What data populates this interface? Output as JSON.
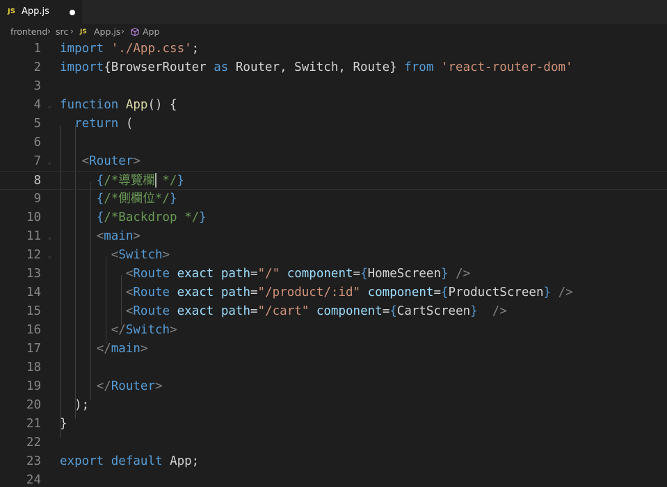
{
  "tab": {
    "badge": "JS",
    "label": "App.js"
  },
  "breadcrumb": {
    "parts": [
      "frontend",
      "src"
    ],
    "file_badge": "JS",
    "file": "App.js",
    "symbol": "App"
  },
  "lines": [
    {
      "n": "1",
      "segs": [
        [
          "kw",
          "import"
        ],
        [
          "plain",
          " "
        ],
        [
          "str",
          "'./App.css'"
        ],
        [
          "plain",
          ";"
        ]
      ]
    },
    {
      "n": "2",
      "segs": [
        [
          "kw",
          "import"
        ],
        [
          "plain",
          "{BrowserRouter "
        ],
        [
          "kw",
          "as"
        ],
        [
          "plain",
          " Router, Switch, Route} "
        ],
        [
          "kw",
          "from"
        ],
        [
          "plain",
          " "
        ],
        [
          "str",
          "'react-router-dom'"
        ]
      ]
    },
    {
      "n": "3",
      "segs": []
    },
    {
      "n": "4",
      "segs": [
        [
          "kw",
          "function"
        ],
        [
          "plain",
          " "
        ],
        [
          "fn",
          "App"
        ],
        [
          "plain",
          "() {"
        ]
      ]
    },
    {
      "n": "5",
      "segs": [
        [
          "plain",
          "  "
        ],
        [
          "kw",
          "return"
        ],
        [
          "plain",
          " ("
        ]
      ]
    },
    {
      "n": "6",
      "segs": []
    },
    {
      "n": "7",
      "segs": [
        [
          "plain",
          "   "
        ],
        [
          "punct",
          "<"
        ],
        [
          "tag",
          "Router"
        ],
        [
          "punct",
          ">"
        ]
      ]
    },
    {
      "n": "8",
      "segs": [
        [
          "plain",
          "     "
        ],
        [
          "brace",
          "{"
        ],
        [
          "comment",
          "/*導覽欄"
        ],
        [
          "comment",
          " */"
        ],
        [
          "brace",
          "}"
        ]
      ]
    },
    {
      "n": "9",
      "segs": [
        [
          "plain",
          "     "
        ],
        [
          "brace",
          "{"
        ],
        [
          "comment",
          "/*側欄位*/"
        ],
        [
          "brace",
          "}"
        ]
      ]
    },
    {
      "n": "10",
      "segs": [
        [
          "plain",
          "     "
        ],
        [
          "brace",
          "{"
        ],
        [
          "comment",
          "/*Backdrop */"
        ],
        [
          "brace",
          "}"
        ]
      ]
    },
    {
      "n": "11",
      "segs": [
        [
          "plain",
          "     "
        ],
        [
          "punct",
          "<"
        ],
        [
          "tag",
          "main"
        ],
        [
          "punct",
          ">"
        ]
      ]
    },
    {
      "n": "12",
      "segs": [
        [
          "plain",
          "       "
        ],
        [
          "punct",
          "<"
        ],
        [
          "tag",
          "Switch"
        ],
        [
          "punct",
          ">"
        ]
      ]
    },
    {
      "n": "13",
      "segs": [
        [
          "plain",
          "         "
        ],
        [
          "punct",
          "<"
        ],
        [
          "tag",
          "Route"
        ],
        [
          "plain",
          " "
        ],
        [
          "attr",
          "exact"
        ],
        [
          "plain",
          " "
        ],
        [
          "attr",
          "path"
        ],
        [
          "plain",
          "="
        ],
        [
          "str",
          "\"/\""
        ],
        [
          "plain",
          " "
        ],
        [
          "attr",
          "component"
        ],
        [
          "plain",
          "="
        ],
        [
          "brace",
          "{"
        ],
        [
          "comp",
          "HomeScreen"
        ],
        [
          "brace",
          "}"
        ],
        [
          "plain",
          " "
        ],
        [
          "punct",
          "/>"
        ]
      ]
    },
    {
      "n": "14",
      "segs": [
        [
          "plain",
          "         "
        ],
        [
          "punct",
          "<"
        ],
        [
          "tag",
          "Route"
        ],
        [
          "plain",
          " "
        ],
        [
          "attr",
          "exact"
        ],
        [
          "plain",
          " "
        ],
        [
          "attr",
          "path"
        ],
        [
          "plain",
          "="
        ],
        [
          "str",
          "\"/product/:id\""
        ],
        [
          "plain",
          " "
        ],
        [
          "attr",
          "component"
        ],
        [
          "plain",
          "="
        ],
        [
          "brace",
          "{"
        ],
        [
          "comp",
          "ProductScreen"
        ],
        [
          "brace",
          "}"
        ],
        [
          "plain",
          " "
        ],
        [
          "punct",
          "/>"
        ]
      ]
    },
    {
      "n": "15",
      "segs": [
        [
          "plain",
          "         "
        ],
        [
          "punct",
          "<"
        ],
        [
          "tag",
          "Route"
        ],
        [
          "plain",
          " "
        ],
        [
          "attr",
          "exact"
        ],
        [
          "plain",
          " "
        ],
        [
          "attr",
          "path"
        ],
        [
          "plain",
          "="
        ],
        [
          "str",
          "\"/cart\""
        ],
        [
          "plain",
          " "
        ],
        [
          "attr",
          "component"
        ],
        [
          "plain",
          "="
        ],
        [
          "brace",
          "{"
        ],
        [
          "comp",
          "CartScreen"
        ],
        [
          "brace",
          "}"
        ],
        [
          "plain",
          "  "
        ],
        [
          "punct",
          "/>"
        ]
      ]
    },
    {
      "n": "16",
      "segs": [
        [
          "plain",
          "       "
        ],
        [
          "punct",
          "</"
        ],
        [
          "tag",
          "Switch"
        ],
        [
          "punct",
          ">"
        ]
      ]
    },
    {
      "n": "17",
      "segs": [
        [
          "plain",
          "     "
        ],
        [
          "punct",
          "</"
        ],
        [
          "tag",
          "main"
        ],
        [
          "punct",
          ">"
        ]
      ]
    },
    {
      "n": "18",
      "segs": []
    },
    {
      "n": "19",
      "segs": [
        [
          "plain",
          "     "
        ],
        [
          "punct",
          "</"
        ],
        [
          "tag",
          "Router"
        ],
        [
          "punct",
          ">"
        ]
      ]
    },
    {
      "n": "20",
      "segs": [
        [
          "plain",
          "  );"
        ]
      ]
    },
    {
      "n": "21",
      "segs": [
        [
          "plain",
          "}"
        ]
      ]
    },
    {
      "n": "22",
      "segs": []
    },
    {
      "n": "23",
      "segs": [
        [
          "kw",
          "export"
        ],
        [
          "plain",
          " "
        ],
        [
          "kw",
          "default"
        ],
        [
          "plain",
          " App;"
        ]
      ]
    },
    {
      "n": "24",
      "segs": []
    }
  ],
  "current_line": "8",
  "colors": {
    "background": "#1e1e1e",
    "keyword": "#569cd6",
    "string": "#ce9178",
    "comment": "#6a9955",
    "attribute": "#9cdcfe",
    "function": "#dcdcaa",
    "js_badge": "#e4cc3f"
  }
}
